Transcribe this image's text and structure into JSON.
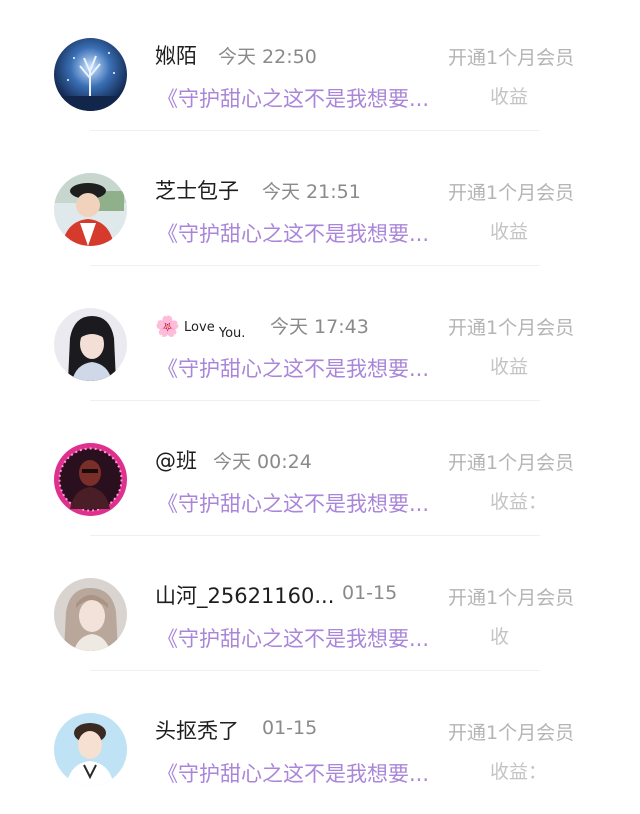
{
  "messages": [
    {
      "name": "娰陌",
      "time": "今天 22:50",
      "preview": "《守护甜心之这不是我想要...",
      "vip_text": "开通1个月会员",
      "earn_text": "收益",
      "avatar": "night-forest-tree"
    },
    {
      "name": "芝士包子",
      "time": "今天 21:51",
      "preview": "《守护甜心之这不是我想要...",
      "vip_text": "开通1个月会员",
      "earn_text": "收益",
      "avatar": "boy-with-hat"
    },
    {
      "name_prefix": "🌸",
      "name_love": "Love",
      "name_you": "You.",
      "time": "今天 17:43",
      "preview": "《守护甜心之这不是我想要...",
      "vip_text": "开通1个月会员",
      "earn_text": "收益",
      "avatar": "girl-long-hair"
    },
    {
      "name": "@班",
      "time": "今天 00:24",
      "preview": "《守护甜心之这不是我想要...",
      "vip_text": "开通1个月会员",
      "earn_text": "收益：",
      "avatar": "dark-figure-pink-frame"
    },
    {
      "name": "山河_25621160...",
      "time": "01-15",
      "preview": "《守护甜心之这不是我想要...",
      "vip_text": "开通1个月会员",
      "earn_text": "收",
      "avatar": "woman-portrait"
    },
    {
      "name": "头抠秃了",
      "time": "01-15",
      "preview": "《守护甜心之这不是我想要...",
      "vip_text": "开通1个月会员",
      "earn_text": "收益：",
      "avatar": "boy-white-shirt"
    }
  ]
}
